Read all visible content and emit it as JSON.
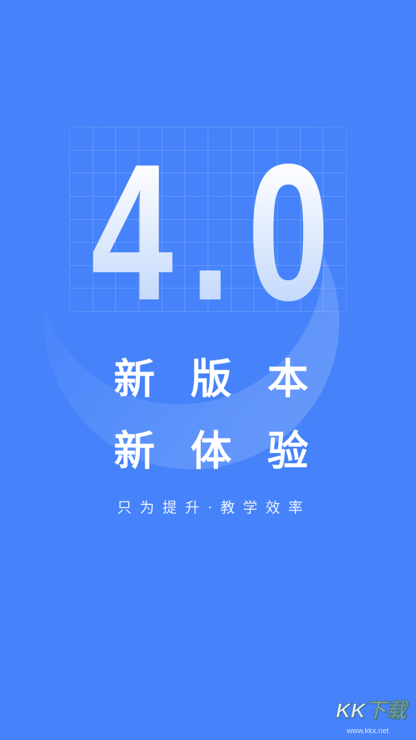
{
  "splash": {
    "version": "4.0",
    "headline_line1": "新版本",
    "headline_line2": "新体验",
    "tagline": "只为提升·教学效率"
  },
  "watermark": {
    "logo_text": "KK下载",
    "url": "www.kkx.net"
  },
  "colors": {
    "background": "#4683fa",
    "version_gradient_top": "#ffffff",
    "version_gradient_bottom": "#c6dafb",
    "text": "#ffffff"
  }
}
